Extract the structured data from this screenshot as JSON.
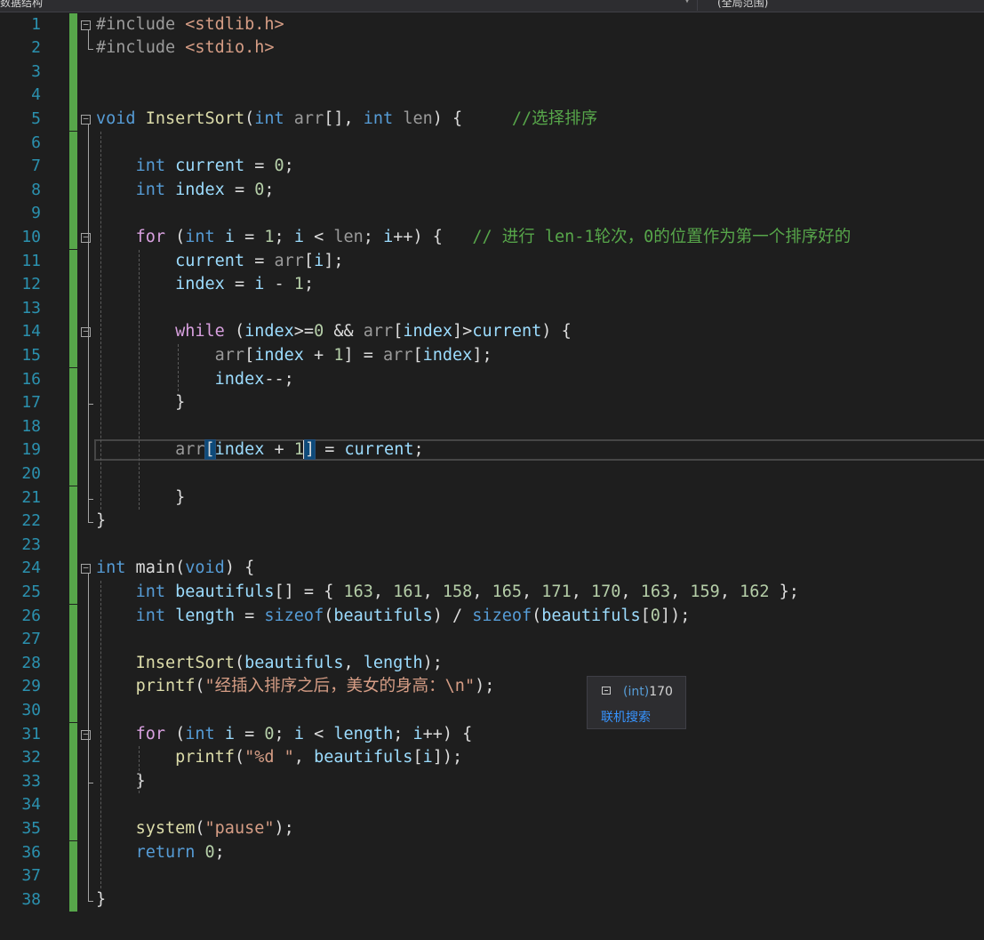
{
  "toolbar": {
    "left_label": "数据结构",
    "right_label": "(全局范围)"
  },
  "tooltip": {
    "type": "(int)",
    "value": "170",
    "link": "联机搜索"
  },
  "lines": [
    {
      "n": "1",
      "t": "#include <stdlib.h>"
    },
    {
      "n": "2",
      "t": "#include <stdio.h>"
    },
    {
      "n": "3",
      "t": ""
    },
    {
      "n": "4",
      "t": ""
    },
    {
      "n": "5",
      "t": "void InsertSort(int arr[], int len) {     //选择排序"
    },
    {
      "n": "6",
      "t": ""
    },
    {
      "n": "7",
      "t": "    int current = 0;"
    },
    {
      "n": "8",
      "t": "    int index = 0;"
    },
    {
      "n": "9",
      "t": ""
    },
    {
      "n": "10",
      "t": "    for (int i = 1; i < len; i++) {   // 进行 len-1轮次，0的位置作为第一个排序好的"
    },
    {
      "n": "11",
      "t": "        current = arr[i];"
    },
    {
      "n": "12",
      "t": "        index = i - 1;"
    },
    {
      "n": "13",
      "t": ""
    },
    {
      "n": "14",
      "t": "        while (index>=0 && arr[index]>current) {"
    },
    {
      "n": "15",
      "t": "            arr[index + 1] = arr[index];"
    },
    {
      "n": "16",
      "t": "            index--;"
    },
    {
      "n": "17",
      "t": "        }"
    },
    {
      "n": "18",
      "t": ""
    },
    {
      "n": "19",
      "t": "        arr[index + 1] = current;"
    },
    {
      "n": "20",
      "t": ""
    },
    {
      "n": "21",
      "t": "        }"
    },
    {
      "n": "22",
      "t": "}"
    },
    {
      "n": "23",
      "t": ""
    },
    {
      "n": "24",
      "t": "int main(void) {"
    },
    {
      "n": "25",
      "t": "    int beautifuls[] = { 163, 161, 158, 165, 171, 170, 163, 159, 162 };"
    },
    {
      "n": "26",
      "t": "    int length = sizeof(beautifuls) / sizeof(beautifuls[0]);"
    },
    {
      "n": "27",
      "t": ""
    },
    {
      "n": "28",
      "t": "    InsertSort(beautifuls, length);"
    },
    {
      "n": "29",
      "t": "    printf(\"经插入排序之后，美女的身高：\\n\");"
    },
    {
      "n": "30",
      "t": ""
    },
    {
      "n": "31",
      "t": "    for (int i = 0; i < length; i++) {"
    },
    {
      "n": "32",
      "t": "        printf(\"%d \", beautifuls[i]);"
    },
    {
      "n": "33",
      "t": "    }"
    },
    {
      "n": "34",
      "t": ""
    },
    {
      "n": "35",
      "t": "    system(\"pause\");"
    },
    {
      "n": "36",
      "t": "    return 0;"
    },
    {
      "n": "37",
      "t": ""
    },
    {
      "n": "38",
      "t": "}"
    }
  ],
  "colors": {
    "background": "#1e1e1e",
    "line_number": "#2b91af",
    "keyword": "#569cd6",
    "comment": "#57a64a",
    "string": "#d69d85",
    "function": "#dcdcaa",
    "change_marker": "#57a64a"
  },
  "icons": {
    "collapse": "minus-box-icon",
    "tooltip": "quick-info-icon"
  }
}
